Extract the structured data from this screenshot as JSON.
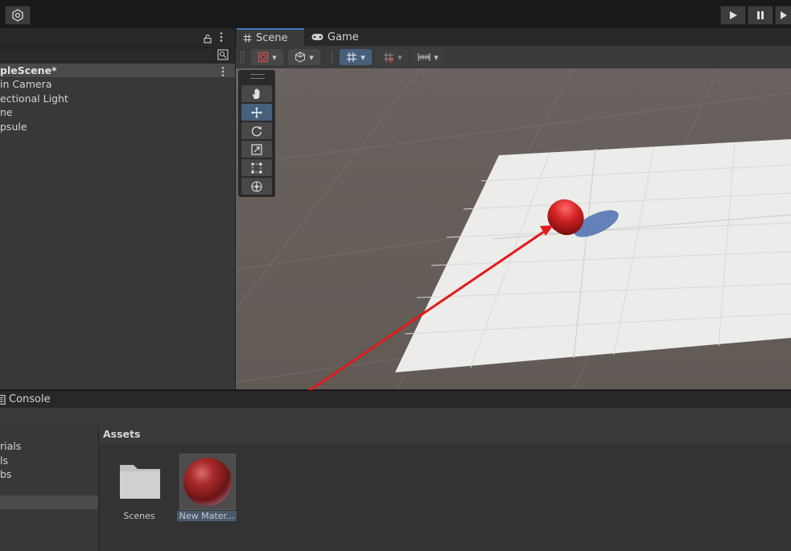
{
  "toolbar": {
    "logo_icon": "unity-cloud-icon",
    "play_icon": "play-icon",
    "pause_icon": "pause-icon",
    "step_icon": "step-icon"
  },
  "hierarchy": {
    "scene_name": "pleScene*",
    "items": [
      "in Camera",
      "ectional Light",
      "ne",
      "psule"
    ]
  },
  "scene_view": {
    "tabs": [
      {
        "label": "Scene",
        "icon": "hash-grid-icon",
        "active": true
      },
      {
        "label": "Game",
        "icon": "gamepad-icon",
        "active": false
      }
    ],
    "tools": [
      "hand-tool-icon",
      "move-tool-icon",
      "rotate-tool-icon",
      "scale-tool-icon",
      "rect-tool-icon",
      "transform-tool-icon"
    ],
    "active_tool": "move-tool-icon",
    "colors": {
      "ground": "#6e6660",
      "plane": "#ececea",
      "capsule": "#cc2020",
      "arrow": "#e01a1a",
      "selection": "#46607c"
    }
  },
  "console": {
    "tab_label": "Console"
  },
  "project": {
    "tree_items": [
      "rials",
      "ls",
      "bs"
    ],
    "assets_header": "Assets",
    "assets": [
      {
        "label": "Scenes",
        "icon": "folder-icon"
      },
      {
        "label": "New Mater...",
        "icon": "material-sphere-icon"
      }
    ]
  }
}
